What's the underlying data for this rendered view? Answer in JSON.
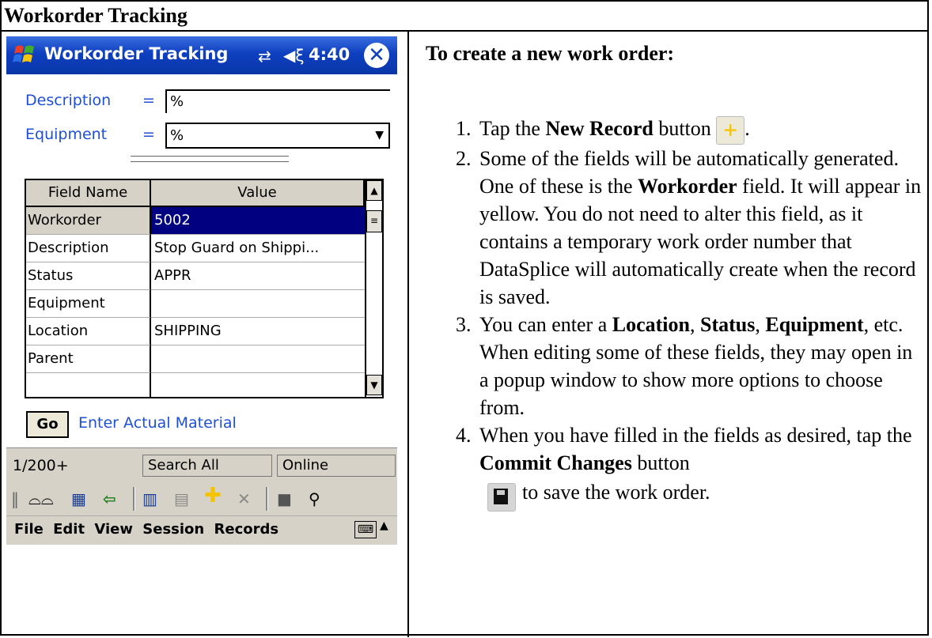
{
  "doc_title": "Workorder Tracking",
  "device": {
    "app_title": "Workorder Tracking",
    "clock": "4:40",
    "icons": [
      "windows-start-icon",
      "connectivity-icon",
      "volume-icon",
      "close-icon"
    ],
    "filters": {
      "description": {
        "label": "Description",
        "op": "=",
        "value": "%"
      },
      "equipment": {
        "label": "Equipment",
        "op": "=",
        "value": "%"
      }
    },
    "grid": {
      "headers": [
        "Field Name",
        "Value"
      ],
      "rows": [
        {
          "name": "Workorder",
          "value": "5002",
          "selected": true
        },
        {
          "name": "Description",
          "value": "Stop Guard on Shippi..."
        },
        {
          "name": "Status",
          "value": "APPR"
        },
        {
          "name": "Equipment",
          "value": ""
        },
        {
          "name": "Location",
          "value": "SHIPPING"
        },
        {
          "name": "Parent",
          "value": ""
        }
      ]
    },
    "go_button": "Go",
    "action_link": "Enter Actual Material",
    "status": {
      "record_count": "1/200+",
      "search_scope": "Search All",
      "mode": "Online"
    },
    "toolbar_icons": [
      "grip-icon",
      "view-icon",
      "table-icon",
      "back-arrow-icon",
      "list-detail-icon",
      "form-icon",
      "new-record-plus-icon",
      "delete-icon",
      "save-icon",
      "search-icon"
    ],
    "menus": [
      "File",
      "Edit",
      "View",
      "Session",
      "Records"
    ],
    "selection_color": "#000080",
    "title_bar_color": "#0d3fbf",
    "link_color": "#1f4fd6"
  },
  "instructions": {
    "heading": "To create a new work order:",
    "steps": [
      {
        "pre": "Tap the ",
        "b1": "New Record",
        "mid": " button",
        "post": "."
      },
      {
        "a": "Some of the fields will be automatically generated.  One of these is the ",
        "b": "Workorder",
        "c": " field.  It will appear in yellow.  You do not need to alter this field, as it contains a temporary work order number that DataSplice will automatically create when the record is saved."
      },
      {
        "a": "You can enter a ",
        "b1": "Location",
        "sep1": ", ",
        "b2": "Status",
        "sep2": ", ",
        "b3": "Equipment",
        "c": ", etc.  When editing some of these fields, they may open in a popup window to show more options to choose from."
      },
      {
        "a": "When you have filled in the fields as desired, tap the ",
        "b": "Commit Changes",
        "c": " button",
        "d": "to save the work order."
      }
    ]
  }
}
